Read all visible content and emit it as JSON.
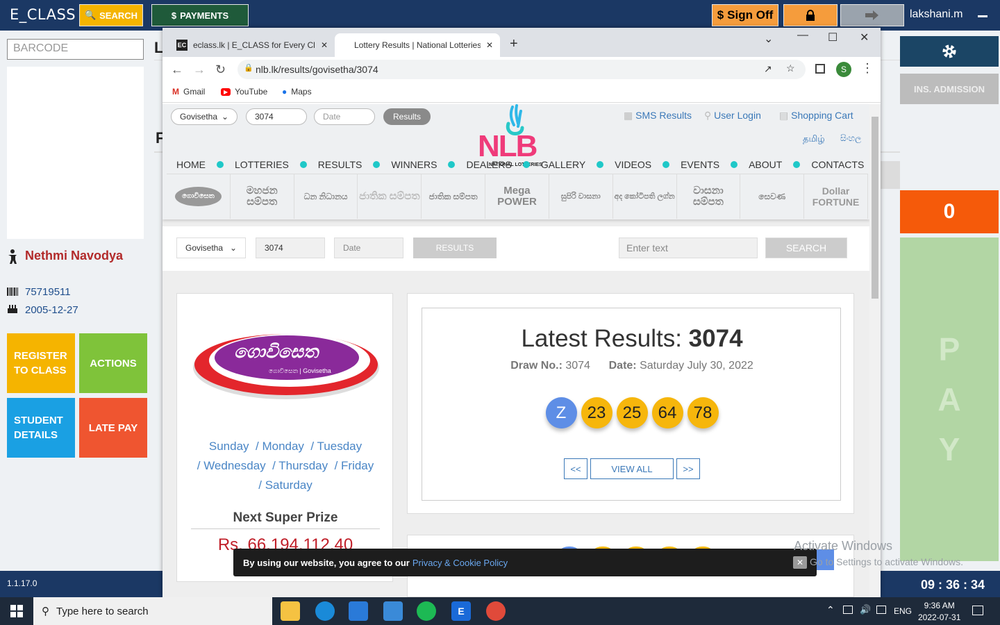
{
  "app": {
    "title": "E_CLASS",
    "search_label": "SEARCH",
    "payments_label": "PAYMENTS",
    "signoff_label": "Sign Off",
    "user_name": "lakshani.m",
    "barcode_placeholder": "BARCODE",
    "student": {
      "name": "Nethmi Navodya",
      "id": "75719511",
      "dob": "2005-12-27"
    },
    "tiles": {
      "register": "REGISTER TO CLASS",
      "actions": "ACTIONS",
      "student_details": "STUDENT DETAILS",
      "late_pay": "LATE PAY"
    },
    "ins_admission": "INS. ADMISSION",
    "counter": "0",
    "pay_letters": [
      "P",
      "A",
      "Y"
    ],
    "version": "1.1.17.0",
    "clock": "09 : 36 : 34",
    "main_fragments": [
      "L",
      "F"
    ]
  },
  "browser": {
    "tabs": [
      {
        "favicon": "EC",
        "title": "eclass.lk | E_CLASS for Every Class"
      },
      {
        "favicon": "",
        "title": "Lottery Results | National Lotteries"
      }
    ],
    "url": "nlb.lk/results/govisetha/3074",
    "profile_initial": "S",
    "bookmarks": [
      "Gmail",
      "YouTube",
      "Maps"
    ]
  },
  "nlb": {
    "header_select": "Govisetha",
    "header_draw": "3074",
    "header_date_placeholder": "Date",
    "header_results": "Results",
    "links": [
      "SMS Results",
      "User Login",
      "Shopping Cart"
    ],
    "languages": [
      "தமிழ்",
      "සිංහල"
    ],
    "logo_text": "NLB",
    "logo_sub": "NATIONAL LOTTERIES",
    "nav": [
      "HOME",
      "LOTTERIES",
      "RESULTS",
      "WINNERS",
      "DEALERS",
      "GALLERY",
      "VIDEOS",
      "EVENTS",
      "ABOUT",
      "CONTACTS"
    ],
    "lotteries": [
      "ගොවිසෙත",
      "මහජන සම්පත",
      "ධන නිධානය",
      "ජාතික සම්පත",
      "ජාතික සම්පත",
      "Mega POWER",
      "සුපිරි වාසනා",
      "අද කෝටිපති ලග්න",
      "වාසනා සම්පත",
      "සෙවණ",
      "Dollar FORTUNE"
    ],
    "filter": {
      "select": "Govisetha",
      "draw": "3074",
      "date_placeholder": "Date",
      "results_label": "RESULTS",
      "search_placeholder": "Enter text",
      "search_label": "SEARCH"
    },
    "brand": {
      "name": "ගොවිසෙත",
      "sub": "ගොවිසෙත | Govisetha"
    },
    "days": [
      "Sunday",
      "Monday",
      "Tuesday",
      "Wednesday",
      "Thursday",
      "Friday",
      "Saturday"
    ],
    "next_super_prize_label": "Next Super Prize",
    "next_super_prize_value": "Rs. 66,194,112.40",
    "latest_label": "Latest Results:",
    "latest_draw": "3074",
    "draw_no_label": "Draw No.:",
    "draw_no": "3074",
    "date_label": "Date:",
    "date_value": "Saturday July 30, 2022",
    "balls": [
      "Z",
      "23",
      "25",
      "64",
      "78"
    ],
    "pager": {
      "prev": "<<",
      "view_all": "VIEW ALL",
      "next": ">>"
    },
    "cookie_text": "By using our website, you agree to our",
    "cookie_link": "Privacy & Cookie Policy"
  },
  "watermark": {
    "line1": "Activate Windows",
    "line2": "Go to Settings to activate Windows."
  },
  "taskbar": {
    "search_placeholder": "Type here to search",
    "lang": "ENG",
    "time": "9:36 AM",
    "date": "2022-07-31"
  },
  "colors": {
    "app_navy": "#1b3864",
    "accent_orange": "#f55a0a",
    "pay_green": "#b2d6a4",
    "ball_yellow": "#f6b60c",
    "ball_blue": "#5e8ee6"
  }
}
